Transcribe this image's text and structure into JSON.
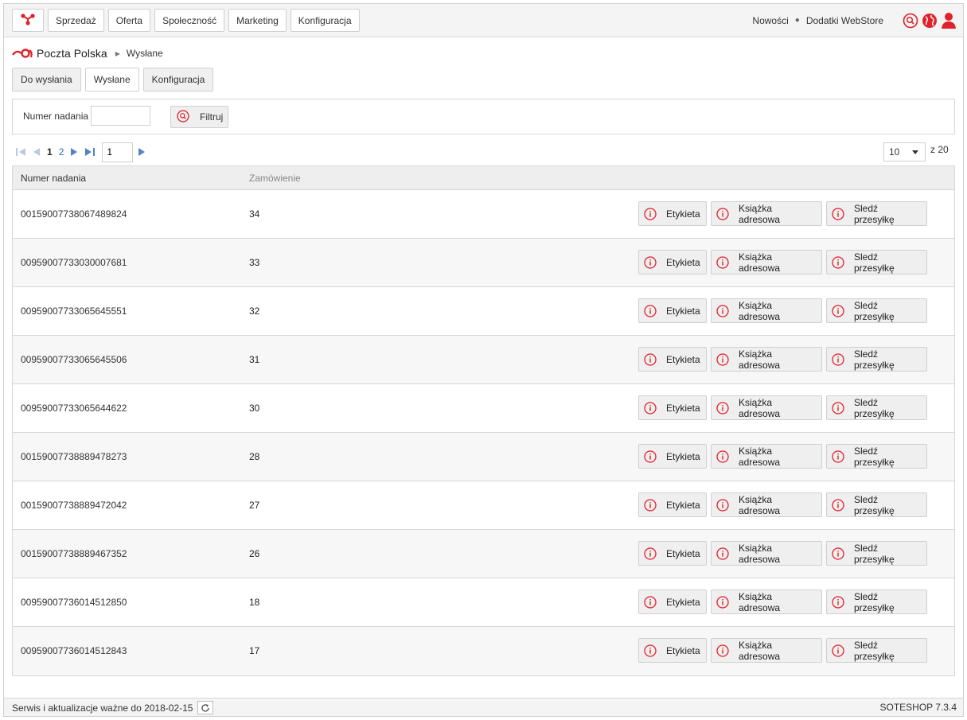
{
  "topnav": {
    "logo_icon": "soteshop-logo-icon",
    "items": [
      "Sprzedaż",
      "Oferta",
      "Społeczność",
      "Marketing",
      "Konfiguracja"
    ],
    "links": [
      "Nowości",
      "Dodatki WebStore"
    ],
    "icons": [
      "search-icon",
      "globe-icon",
      "user-icon"
    ],
    "accent": "#e0202a"
  },
  "breadcrumb": {
    "module": "Poczta Polska",
    "current": "Wysłane"
  },
  "tabs": [
    "Do wysłania",
    "Wysłane",
    "Konfiguracja"
  ],
  "active_tab": "Wysłane",
  "filter": {
    "label": "Numer nadania",
    "value": "",
    "button": "Filtruj"
  },
  "pager": {
    "pages": [
      "1",
      "2"
    ],
    "current_page": "1",
    "page_input": "1",
    "per_page": "10",
    "total": "z 20"
  },
  "table": {
    "columns": [
      "Numer nadania",
      "Zamówienie"
    ],
    "action_labels": [
      "Etykieta",
      "Książka adresowa",
      "Sledź przesyłkę"
    ],
    "rows": [
      {
        "number": "00159007738067489824",
        "order": "34"
      },
      {
        "number": "00959007733030007681",
        "order": "33"
      },
      {
        "number": "00959007733065645551",
        "order": "32"
      },
      {
        "number": "00959007733065645506",
        "order": "31"
      },
      {
        "number": "00959007733065644622",
        "order": "30"
      },
      {
        "number": "00159007738889478273",
        "order": "28"
      },
      {
        "number": "00159007738889472042",
        "order": "27"
      },
      {
        "number": "00159007738889467352",
        "order": "26"
      },
      {
        "number": "00959007736014512850",
        "order": "18"
      },
      {
        "number": "00959007736014512843",
        "order": "17"
      }
    ]
  },
  "footer": {
    "service": "Serwis i aktualizacje ważne do 2018-02-15",
    "version": "SOTESHOP 7.3.4"
  }
}
